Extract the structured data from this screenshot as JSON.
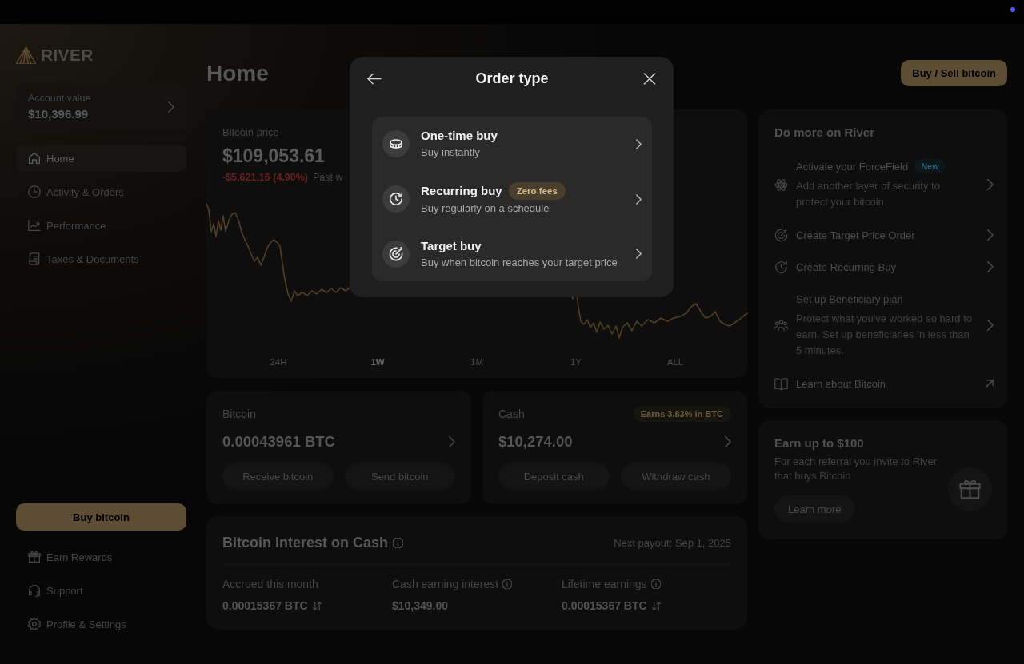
{
  "sidebar": {
    "logo": "RIVER",
    "account": {
      "label": "Account value",
      "value": "$10,396.99"
    },
    "nav": [
      {
        "label": "Home",
        "selected": true
      },
      {
        "label": "Activity & Orders",
        "selected": false
      },
      {
        "label": "Performance",
        "selected": false
      },
      {
        "label": "Taxes & Documents",
        "selected": false
      }
    ],
    "buy_button": "Buy bitcoin",
    "footer_links": [
      {
        "label": "Earn Rewards"
      },
      {
        "label": "Support"
      },
      {
        "label": "Profile & Settings"
      }
    ]
  },
  "header": {
    "title": "Home",
    "action": "Buy / Sell bitcoin"
  },
  "price_card": {
    "label": "Bitcoin price",
    "price": "$109,053.61",
    "change": "-$5,621.16 (4.90%)",
    "period": "Past w",
    "ranges": [
      {
        "label": "24H",
        "selected": false
      },
      {
        "label": "1W",
        "selected": true
      },
      {
        "label": "1M",
        "selected": false
      },
      {
        "label": "1Y",
        "selected": false
      },
      {
        "label": "ALL",
        "selected": false
      }
    ]
  },
  "bitcoin_card": {
    "label": "Bitcoin",
    "balance": "0.00043961 BTC",
    "actions": [
      "Receive bitcoin",
      "Send bitcoin"
    ]
  },
  "cash_card": {
    "label": "Cash",
    "badge": "Earns 3.83% in BTC",
    "balance": "$10,274.00",
    "actions": [
      "Deposit cash",
      "Withdraw cash"
    ]
  },
  "interest_card": {
    "title": "Bitcoin Interest on Cash",
    "next_payout": "Next payout: Sep 1, 2025",
    "stats": [
      {
        "label": "Accrued this month",
        "value": "0.00015367 BTC",
        "info": false,
        "swap": true
      },
      {
        "label": "Cash earning interest",
        "value": "$10,349.00",
        "info": true,
        "swap": false
      },
      {
        "label": "Lifetime earnings",
        "value": "0.00015367 BTC",
        "info": true,
        "swap": true
      }
    ]
  },
  "do_more": {
    "title": "Do more on River",
    "items": [
      {
        "title": "Activate your ForceField",
        "badge": "New",
        "description": "Add another layer of security to protect your bitcoin.",
        "kind": "chevron"
      },
      {
        "title": "Create Target Price Order",
        "kind": "chevron"
      },
      {
        "title": "Create Recurring Buy",
        "kind": "chevron"
      },
      {
        "title": "Set up Beneficiary plan",
        "description": "Protect what you've worked so hard to earn. Set up beneficiaries in less than 5 minutes.",
        "kind": "chevron"
      },
      {
        "title": "Learn about Bitcoin",
        "kind": "external"
      }
    ]
  },
  "referral": {
    "title": "Earn up to $100",
    "text": "For each referral you invite to River that buys Bitcoin",
    "button": "Learn more"
  },
  "modal": {
    "title": "Order type",
    "options": [
      {
        "title": "One-time buy",
        "subtitle": "Buy instantly"
      },
      {
        "title": "Recurring buy",
        "badge": "Zero fees",
        "subtitle": "Buy regularly on a schedule"
      },
      {
        "title": "Target buy",
        "subtitle": "Buy when bitcoin reaches your target price"
      }
    ]
  }
}
